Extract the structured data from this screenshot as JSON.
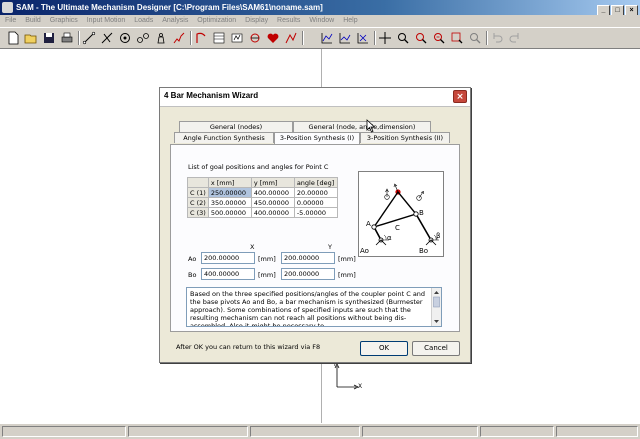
{
  "app": {
    "title": "SAM - The Ultimate Mechanism Designer [C:\\Program Files\\SAM61\\noname.sam]",
    "window_buttons": [
      "_",
      "□",
      "×"
    ]
  },
  "menu": [
    "File",
    "Build",
    "Graphics",
    "Input Motion",
    "Loads",
    "Analysis",
    "Optimization",
    "Display",
    "Results",
    "Window",
    "Help"
  ],
  "toolbar_icons": [
    "new-icon",
    "open-icon",
    "save-icon",
    "print-icon",
    "beam-icon",
    "slider-icon",
    "gear-icon",
    "belt-icon",
    "weight-icon",
    "spring-icon",
    "input-motion-icon",
    "table-icon",
    "run-icon",
    "tracking-icon",
    "heart-icon",
    "optimize-icon",
    "chart-xy-icon",
    "chart-icon",
    "chart-plus-icon",
    "fit-icon",
    "zoom-icon",
    "zoom-out-icon",
    "zoom-window-icon",
    "zoom-all-icon",
    "zoom-prev-icon",
    "undo-icon",
    "redo-icon"
  ],
  "dialog": {
    "title": "4 Bar Mechanism Wizard",
    "tabs_back": [
      "General (nodes)",
      "General (node, angle,dimension)"
    ],
    "tabs_front": [
      "Angle Function Synthesis",
      "3-Position Synthesis (I)",
      "3-Position Synthesis (II)"
    ],
    "goal_label": "List of goal positions and angles for Point C",
    "table": {
      "headers": [
        "",
        "x [mm]",
        "y [mm]",
        "angle [deg]"
      ],
      "rows": [
        [
          "C (1)",
          "250.00000",
          "400.00000",
          "20.00000"
        ],
        [
          "C (2)",
          "350.00000",
          "450.00000",
          "0.00000"
        ],
        [
          "C (3)",
          "500.00000",
          "400.00000",
          "-5.00000"
        ]
      ]
    },
    "pivots": {
      "x_header": "X",
      "y_header": "Y",
      "unit": "[mm]",
      "rows": [
        {
          "label": "Ao",
          "x": "200.00000",
          "y": "200.00000"
        },
        {
          "label": "Bo",
          "x": "400.00000",
          "y": "200.00000"
        }
      ]
    },
    "figure_labels": {
      "a0": "Ao",
      "b0": "Bo",
      "a": "A",
      "b": "B",
      "c": "C",
      "alpha": "α",
      "beta": "β"
    },
    "description": "Based on the three specified positions/angles of the coupler point C and the base pivots Ao and Bo, a  bar mechanism is synthesized (Burmester approach). Some combinations of specified inputs are such that the resulting mechanism can not reach all positions without being dis-assembled. Also it might be necessary to",
    "footer_note": "After OK you can return to this wizard via F8",
    "ok_label": "OK",
    "cancel_label": "Cancel"
  },
  "axes": {
    "x_label": "X",
    "y_label": "Y"
  }
}
